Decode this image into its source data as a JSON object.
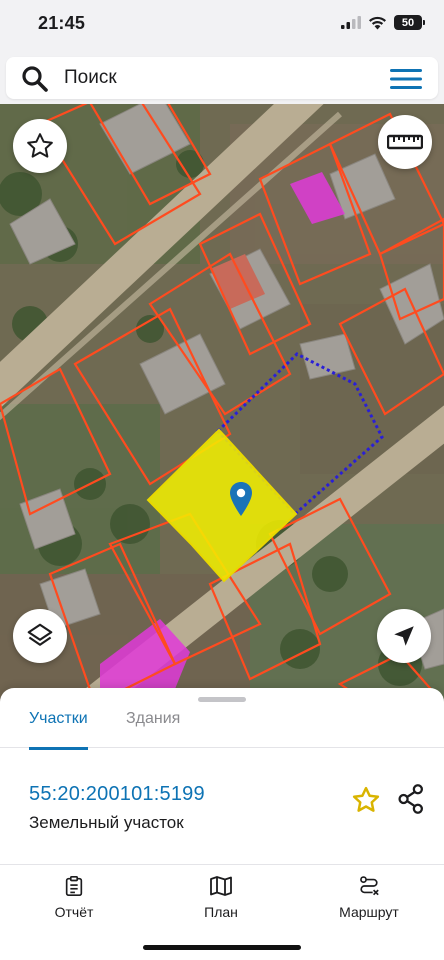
{
  "status_bar": {
    "time": "21:45",
    "battery": "50",
    "icons": [
      "cellular-signal-icon",
      "wifi-icon",
      "battery-icon"
    ]
  },
  "search": {
    "placeholder": "Поиск",
    "value": ""
  },
  "map": {
    "parcel_fill_color": "#f5f100",
    "parcel_border_color": "#e8d800",
    "boundary_color": "#ff4b1f",
    "dotted_boundary_color": "#2a1fd6",
    "building_highlight_color": "#e03ad8",
    "pin_color": "#1a73b8",
    "controls": [
      "star-icon",
      "ruler-icon",
      "layers-icon",
      "navigation-arrow-icon"
    ]
  },
  "sheet": {
    "tabs": [
      {
        "label": "Участки",
        "active": true
      },
      {
        "label": "Здания",
        "active": false
      }
    ],
    "parcel": {
      "cadastral_number": "55:20:200101:5199",
      "type": "Земельный участок"
    }
  },
  "bottom_nav": [
    {
      "label": "Отчёт",
      "icon": "clipboard-icon"
    },
    {
      "label": "План",
      "icon": "map-icon"
    },
    {
      "label": "Маршрут",
      "icon": "route-icon"
    }
  ],
  "colors": {
    "accent": "#0e73b4",
    "star": "#d9b400"
  }
}
